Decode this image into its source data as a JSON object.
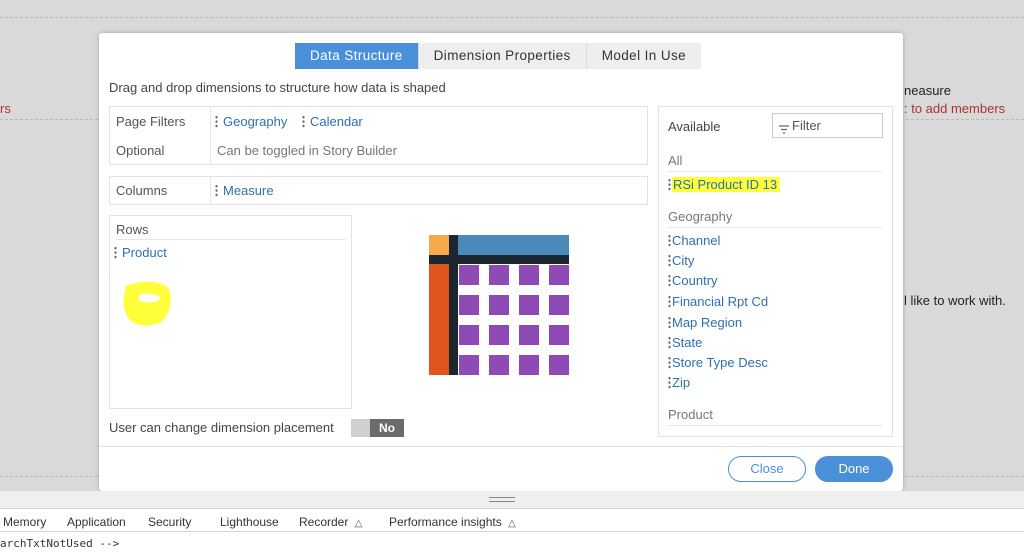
{
  "background": {
    "left_text_top": "rs",
    "right_heading": "neasure",
    "right_link": ": to add members",
    "right_sentence": "l like to work with."
  },
  "modal": {
    "tabs": [
      {
        "label": "Data Structure",
        "active": true
      },
      {
        "label": "Dimension Properties",
        "active": false
      },
      {
        "label": "Model In Use",
        "active": false
      }
    ],
    "instructions": "Drag and drop dimensions to structure how data is shaped",
    "page_filters": {
      "label": "Page Filters",
      "items": [
        "Geography",
        "Calendar"
      ],
      "optional_label": "Optional",
      "optional_text": "Can be toggled in Story Builder"
    },
    "columns": {
      "label": "Columns",
      "items": [
        "Measure"
      ]
    },
    "rows": {
      "label": "Rows",
      "items": [
        "Product"
      ]
    },
    "placement": {
      "label": "User can change dimension placement",
      "toggle_value": "No"
    },
    "available": {
      "title": "Available",
      "filter_placeholder": "Filter",
      "groups": [
        {
          "name": "All",
          "items": [
            "RSi Product ID 13"
          ],
          "highlighted": "RSi Product ID 13"
        },
        {
          "name": "Geography",
          "items": [
            "Channel",
            "City",
            "Country",
            "Financial Rpt Cd",
            "Map Region",
            "State",
            "Store Type Desc",
            "Zip"
          ]
        },
        {
          "name": "Product",
          "items": []
        }
      ]
    },
    "buttons": {
      "close": "Close",
      "done": "Done"
    }
  },
  "colors": {
    "accent": "#4a90d9",
    "highlight": "#ffff3a",
    "grid_cell": "#8e4ab5",
    "grid_header": "#4a8ab8",
    "grid_rowheader": "#e2541f",
    "grid_corner": "#f5a94a",
    "grid_divider": "#1b2630"
  },
  "devtools": {
    "tabs": [
      "Memory",
      "Application",
      "Security",
      "Lighthouse",
      "Recorder",
      "Performance insights"
    ],
    "code_line": "archTxtNotUsed -->"
  }
}
